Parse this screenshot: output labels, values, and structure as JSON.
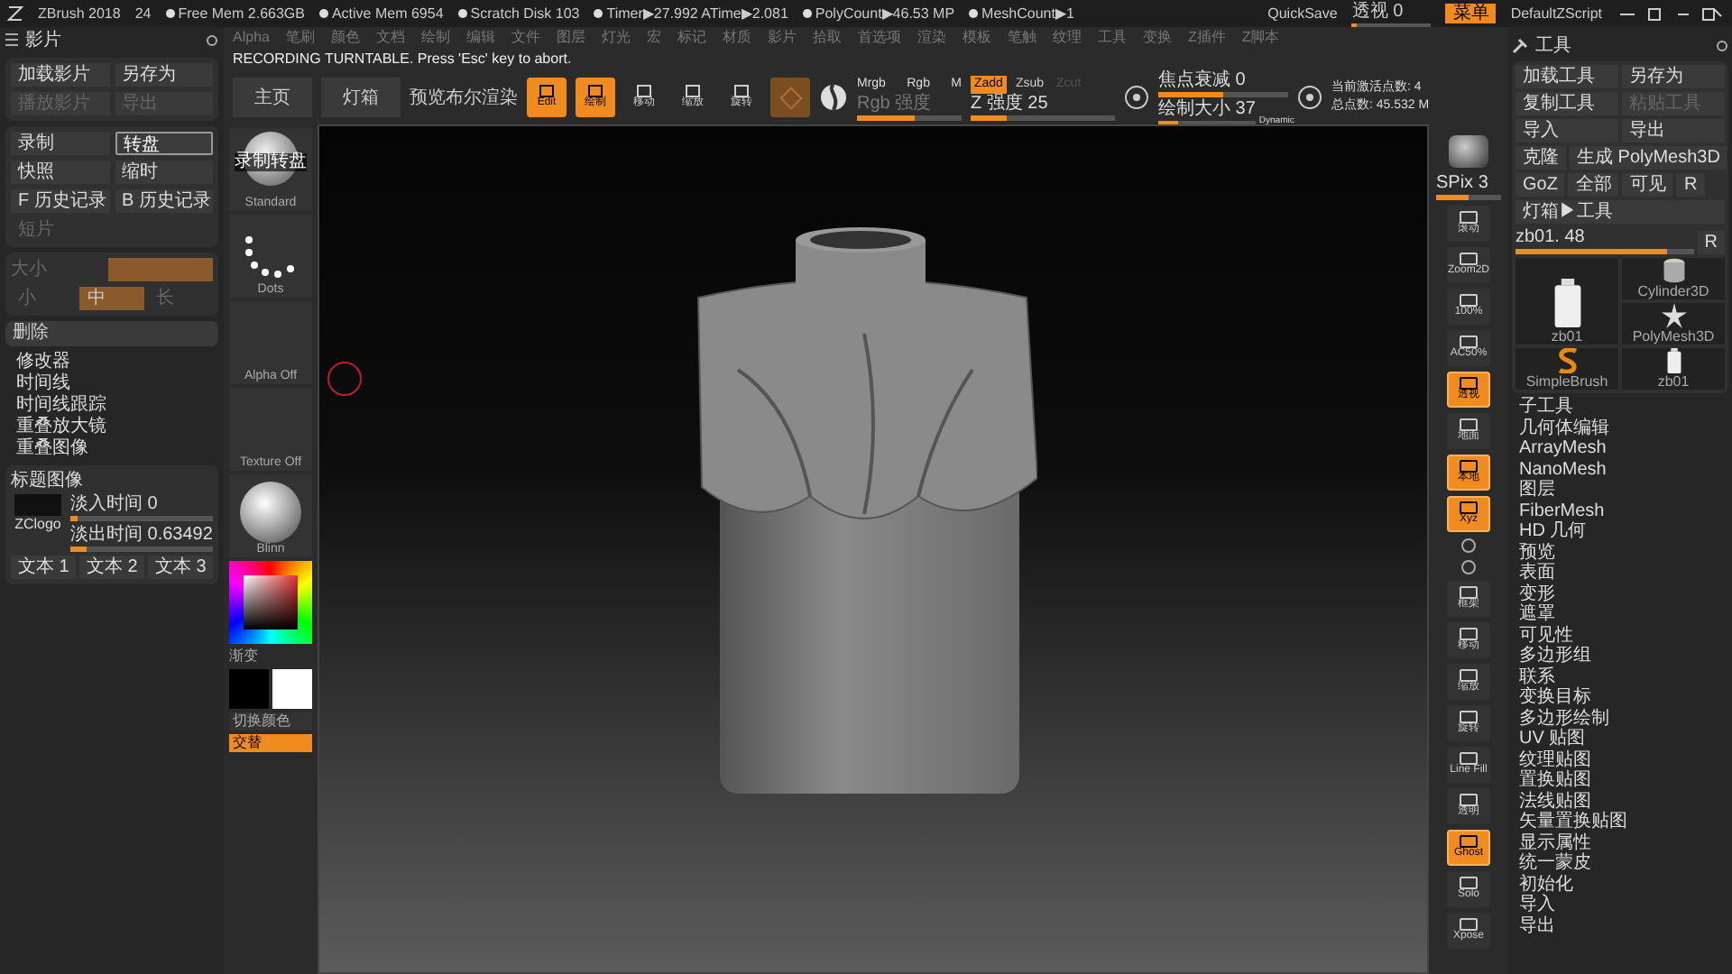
{
  "status_bar": {
    "app": "ZBrush 2018",
    "number": "24",
    "items": [
      "Free Mem 2.663GB",
      "Active Mem 6954",
      "Scratch Disk 103",
      "Timer▶27.992 ATime▶2.081",
      "PolyCount▶46.53 MP",
      "MeshCount▶1"
    ],
    "quicksave": "QuickSave",
    "perspective": {
      "label": "透视 0",
      "level": 0.05
    },
    "menu_button": {
      "label": "菜单",
      "selected": true
    },
    "script": "DefaultZScript"
  },
  "menu": [
    "Alpha",
    "笔刷",
    "颜色",
    "文档",
    "绘制",
    "编辑",
    "文件",
    "图层",
    "灯光",
    "宏",
    "标记",
    "材质",
    "影片",
    "拾取",
    "首选项",
    "渲染",
    "模板",
    "笔触",
    "纹理",
    "工具",
    "变换",
    "Z插件",
    "Z脚本"
  ],
  "message": "RECORDING TURNTABLE. Press 'Esc' key to abort.",
  "toolbar": {
    "buttons": [
      "主页",
      "灯箱"
    ],
    "bool_render": "预览布尔渲染",
    "modes": [
      {
        "label": "Edit",
        "selected": true
      },
      {
        "label": "绘制",
        "selected": true
      },
      {
        "label": "移动",
        "selected": false
      },
      {
        "label": "缩放",
        "selected": false
      },
      {
        "label": "旋转",
        "selected": false
      }
    ],
    "channels": [
      "Mrgb",
      "Rgb",
      "M"
    ],
    "rgb_intensity": {
      "label": "Rgb 强度",
      "level": 0.55
    },
    "z_modes": [
      {
        "label": "Zadd",
        "selected": true,
        "disabled": false
      },
      {
        "label": "Zsub",
        "selected": false,
        "disabled": false
      },
      {
        "label": "Zcut",
        "selected": false,
        "disabled": true
      }
    ],
    "z_intensity": {
      "label": "Z 强度 25",
      "level": 0.25
    },
    "focal": {
      "label": "焦点衰减 0",
      "level": 0.5
    },
    "draw_size": {
      "label": "绘制大小 37",
      "level": 0.2
    },
    "dynamic": "Dynamic",
    "active_points": "当前激活点数: 4",
    "total_points": "总点数: 45.532 M"
  },
  "movie_panel": {
    "title": "影片",
    "file_buttons": [
      {
        "label": "加载影片",
        "disabled": false
      },
      {
        "label": "另存为",
        "disabled": false
      },
      {
        "label": "播放影片",
        "disabled": true
      },
      {
        "label": "导出",
        "disabled": true
      }
    ],
    "record_buttons": [
      {
        "label": "录制",
        "selected": false
      },
      {
        "label": "转盘",
        "selected": true
      },
      {
        "label": "快照",
        "selected": false
      },
      {
        "label": "缩时",
        "selected": false
      },
      {
        "label": "F 历史记录",
        "selected": false
      },
      {
        "label": "B 历史记录",
        "selected": false
      }
    ],
    "clip": "短片",
    "size": {
      "label": "大小",
      "level": 1
    },
    "size_options": [
      {
        "label": "小",
        "selected": false
      },
      {
        "label": "中",
        "selected": true
      },
      {
        "label": "长",
        "selected": false
      }
    ],
    "delete": "删除",
    "items": [
      "修改器",
      "时间线",
      "时间线跟踪",
      "重叠放大镜",
      "重叠图像"
    ],
    "title_image": {
      "title": "标题图像",
      "logo": "ZClogo",
      "fade_in": {
        "label": "淡入时间 0",
        "level": 0.05
      },
      "fade_out": {
        "label": "淡出时间 0.63492",
        "level": 0.12
      },
      "texts": [
        "文本 1",
        "文本 2",
        "文本 3"
      ]
    }
  },
  "tool_column": {
    "material": {
      "overlay": "录制转盘",
      "label": "Standard"
    },
    "stroke": "Dots",
    "alpha": "Alpha Off",
    "texture": "Texture Off",
    "material2": "Blinn",
    "gradient": "渐变",
    "swap": "切换颜色",
    "alternate": {
      "label": "交替",
      "selected": true
    }
  },
  "right_shelf": [
    {
      "kind": "sphere"
    },
    {
      "kind": "slider",
      "label": "SPix 3",
      "level": 0.5
    },
    {
      "kind": "button",
      "label": "滚动",
      "selected": false
    },
    {
      "kind": "button",
      "label": "Zoom2D",
      "selected": false
    },
    {
      "kind": "button",
      "label": "100%",
      "selected": false
    },
    {
      "kind": "button",
      "label": "AC50%",
      "selected": false
    },
    {
      "kind": "button",
      "label": "透视",
      "selected": true
    },
    {
      "kind": "button",
      "label": "地面",
      "selected": false
    },
    {
      "kind": "button",
      "label": "本地",
      "selected": true
    },
    {
      "kind": "button",
      "label": "Xyz",
      "selected": true
    },
    {
      "kind": "small"
    },
    {
      "kind": "small"
    },
    {
      "kind": "button",
      "label": "框架",
      "selected": false
    },
    {
      "kind": "button",
      "label": "移动",
      "selected": false
    },
    {
      "kind": "button",
      "label": "缩放",
      "selected": false
    },
    {
      "kind": "button",
      "label": "旋转",
      "selected": false
    },
    {
      "kind": "button",
      "label": "Line Fill",
      "selected": false
    },
    {
      "kind": "button",
      "label": "透明",
      "selected": false
    },
    {
      "kind": "button",
      "label": "Ghost",
      "selected": true
    },
    {
      "kind": "button",
      "label": "Solo",
      "selected": false
    },
    {
      "kind": "button",
      "label": "Xpose",
      "selected": false
    }
  ],
  "tool_panel": {
    "title": "工具",
    "buttons": [
      {
        "label": "加载工具",
        "disabled": false
      },
      {
        "label": "另存为",
        "disabled": false
      },
      {
        "label": "复制工具",
        "disabled": false
      },
      {
        "label": "粘贴工具",
        "disabled": true
      },
      {
        "label": "导入",
        "disabled": false
      },
      {
        "label": "导出",
        "disabled": false
      }
    ],
    "clone": "克隆",
    "make_polymesh": "生成 PolyMesh3D",
    "goz": "GoZ",
    "all": "全部",
    "visible": "可见",
    "r": "R",
    "lightbox": "灯箱▶工具",
    "current": {
      "label": "zb01. 48",
      "level": 0.85
    },
    "r2": "R",
    "thumbnails": [
      {
        "label": "zb01",
        "kind": "bottle"
      },
      {
        "label": "SimpleBrush",
        "kind": "brush"
      },
      {
        "label": "Cylinder3D",
        "kind": "cylinder"
      },
      {
        "label": "PolyMesh3D",
        "kind": "star"
      },
      {
        "label": "zb01",
        "kind": "bottle_small"
      }
    ],
    "items": [
      "子工具",
      "几何体编辑",
      "ArrayMesh",
      "NanoMesh",
      "图层",
      "FiberMesh",
      "HD 几何",
      "预览",
      "表面",
      "变形",
      "遮罩",
      "可见性",
      "多边形组",
      "联系",
      "变换目标",
      "多边形绘制",
      "UV 贴图",
      "纹理贴图",
      "置换贴图",
      "法线贴图",
      "矢量置换贴图",
      "显示属性",
      "统一蒙皮",
      "初始化",
      "导入",
      "导出"
    ]
  }
}
